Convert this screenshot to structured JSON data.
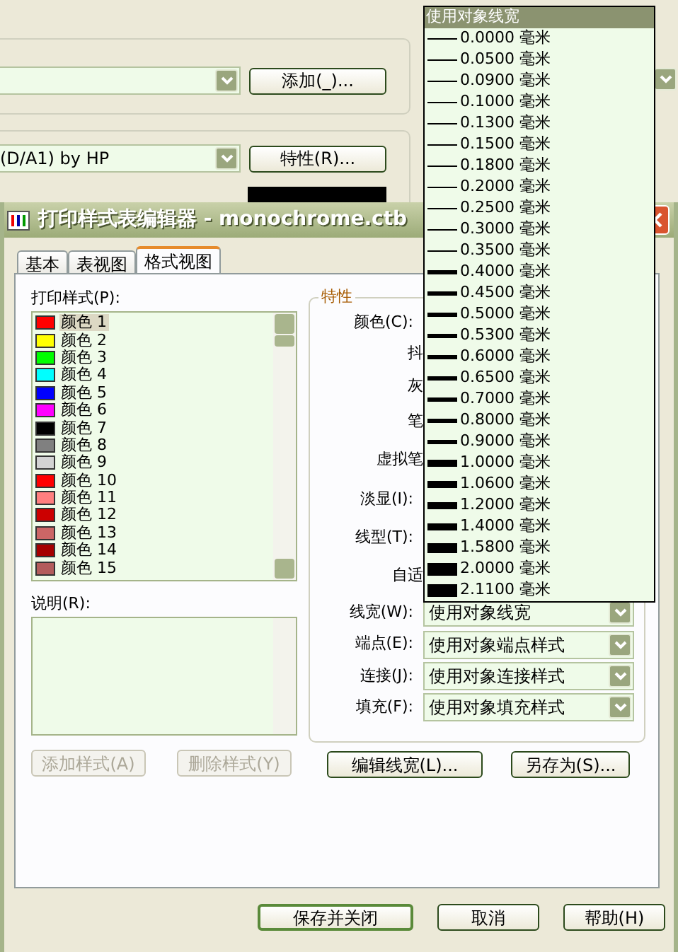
{
  "background_window": {
    "add_button": "添加(_)...",
    "plotter_combo": {
      "value": "(D/A1) by HP"
    },
    "properties_button": "特性(R)..."
  },
  "dialog": {
    "title": "打印样式表编辑器 - monochrome.ctb",
    "tabs": [
      {
        "label": "基本",
        "selected": false
      },
      {
        "label": "表视图",
        "selected": false
      },
      {
        "label": "格式视图",
        "selected": true
      }
    ],
    "styles_label": "打印样式(P):",
    "styles": [
      {
        "label": "颜色 1",
        "color": "#ff0000",
        "selected": true
      },
      {
        "label": "颜色 2",
        "color": "#ffff00",
        "selected": false
      },
      {
        "label": "颜色 3",
        "color": "#00ff00",
        "selected": false
      },
      {
        "label": "颜色 4",
        "color": "#00ffff",
        "selected": false
      },
      {
        "label": "颜色 5",
        "color": "#0000ff",
        "selected": false
      },
      {
        "label": "颜色 6",
        "color": "#ff00ff",
        "selected": false
      },
      {
        "label": "颜色 7",
        "color": "#000000",
        "selected": false
      },
      {
        "label": "颜色 8",
        "color": "#808080",
        "selected": false
      },
      {
        "label": "颜色 9",
        "color": "#d3d3d3",
        "selected": false
      },
      {
        "label": "颜色 10",
        "color": "#ff0000",
        "selected": false
      },
      {
        "label": "颜色 11",
        "color": "#ff7f7f",
        "selected": false
      },
      {
        "label": "颜色 12",
        "color": "#cc0000",
        "selected": false
      },
      {
        "label": "颜色 13",
        "color": "#cc6666",
        "selected": false
      },
      {
        "label": "颜色 14",
        "color": "#a50000",
        "selected": false
      },
      {
        "label": "颜色 15",
        "color": "#b35c5c",
        "selected": false
      }
    ],
    "description_label": "说明(R):",
    "add_style_button": {
      "label": "添加样式(A)",
      "disabled": true
    },
    "delete_style_button": {
      "label": "删除样式(Y)",
      "disabled": true
    },
    "properties_title": "特性",
    "properties": [
      {
        "kind": "label",
        "label": "颜色(C):"
      },
      {
        "kind": "cut",
        "label": "抖"
      },
      {
        "kind": "cut",
        "label": "灰"
      },
      {
        "kind": "cut",
        "label": "笔"
      },
      {
        "kind": "cut",
        "label": "虚拟笔"
      },
      {
        "kind": "label",
        "label": "淡显(I):"
      },
      {
        "kind": "label",
        "label": "线型(T):"
      },
      {
        "kind": "cut",
        "label": "自适"
      },
      {
        "kind": "combo",
        "label": "线宽(W):",
        "value": "使用对象线宽"
      },
      {
        "kind": "combo",
        "label": "端点(E):",
        "value": "使用对象端点样式"
      },
      {
        "kind": "combo",
        "label": "连接(J):",
        "value": "使用对象连接样式"
      },
      {
        "kind": "combo",
        "label": "填充(F):",
        "value": "使用对象填充样式"
      }
    ],
    "edit_lineweights_button": "编辑线宽(L)...",
    "save_as_button": "另存为(S)...",
    "footer_buttons": [
      {
        "label": "保存并关闭",
        "kind": "default"
      },
      {
        "label": "取消",
        "kind": "normal"
      },
      {
        "label": "帮助(H)",
        "kind": "normal"
      }
    ]
  },
  "lineweight_dropdown": {
    "header": {
      "label": "使用对象线宽",
      "selected": true
    },
    "items": [
      {
        "label": "0.0000 毫米",
        "kind": "thin"
      },
      {
        "label": "0.0500 毫米",
        "kind": "thin"
      },
      {
        "label": "0.0900 毫米",
        "kind": "thin"
      },
      {
        "label": "0.1000 毫米",
        "kind": "thin"
      },
      {
        "label": "0.1300 毫米",
        "kind": "thin"
      },
      {
        "label": "0.1500 毫米",
        "kind": "thin"
      },
      {
        "label": "0.1800 毫米",
        "kind": "thin"
      },
      {
        "label": "0.2000 毫米",
        "kind": "thin"
      },
      {
        "label": "0.2500 毫米",
        "kind": "thin"
      },
      {
        "label": "0.3000 毫米",
        "kind": "thin"
      },
      {
        "label": "0.3500 毫米",
        "kind": "thin"
      },
      {
        "label": "0.4000 毫米",
        "kind": "medium"
      },
      {
        "label": "0.4500 毫米",
        "kind": "medium"
      },
      {
        "label": "0.5000 毫米",
        "kind": "medium"
      },
      {
        "label": "0.5300 毫米",
        "kind": "medium"
      },
      {
        "label": "0.6000 毫米",
        "kind": "medium"
      },
      {
        "label": "0.6500 毫米",
        "kind": "medium"
      },
      {
        "label": "0.7000 毫米",
        "kind": "medium"
      },
      {
        "label": "0.8000 毫米",
        "kind": "medium"
      },
      {
        "label": "0.9000 毫米",
        "kind": "medium"
      },
      {
        "label": "1.0000 毫米",
        "kind": "thick"
      },
      {
        "label": "1.0600 毫米",
        "kind": "thick"
      },
      {
        "label": "1.2000 毫米",
        "kind": "thick"
      },
      {
        "label": "1.4000 毫米",
        "kind": "thick"
      },
      {
        "label": "1.5800 毫米",
        "kind": "heavy"
      },
      {
        "label": "2.0000 毫米",
        "kind": "heaviest"
      },
      {
        "label": "2.1100 毫米",
        "kind": "heaviest"
      }
    ]
  }
}
